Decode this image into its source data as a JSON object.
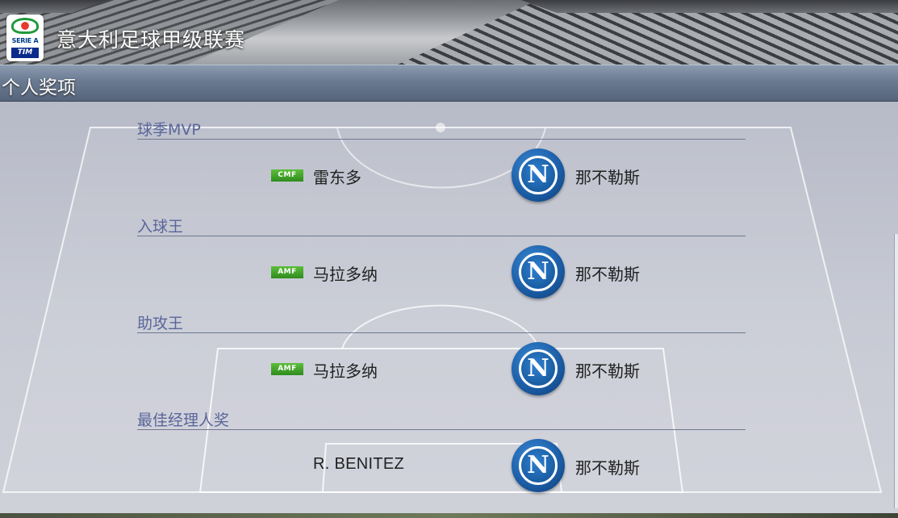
{
  "header": {
    "league_title": "意大利足球甲级联赛",
    "logo": {
      "serie": "SERIE A",
      "sponsor": "TIM"
    }
  },
  "section": {
    "title": "个人奖项"
  },
  "awards": [
    {
      "label": "球季MVP",
      "position": "CMF",
      "player": "雷东多",
      "club_badge": "N",
      "club": "那不勒斯"
    },
    {
      "label": "入球王",
      "position": "AMF",
      "player": "马拉多纳",
      "club_badge": "N",
      "club": "那不勒斯"
    },
    {
      "label": "助攻王",
      "position": "AMF",
      "player": "马拉多纳",
      "club_badge": "N",
      "club": "那不勒斯"
    },
    {
      "label": "最佳经理人奖",
      "position": "",
      "player": "R. BENITEZ",
      "club_badge": "N",
      "club": "那不勒斯"
    }
  ],
  "colors": {
    "position_badge": "#3fa12a",
    "club_badge": "#1d5fa8",
    "award_label": "#5a6699"
  }
}
